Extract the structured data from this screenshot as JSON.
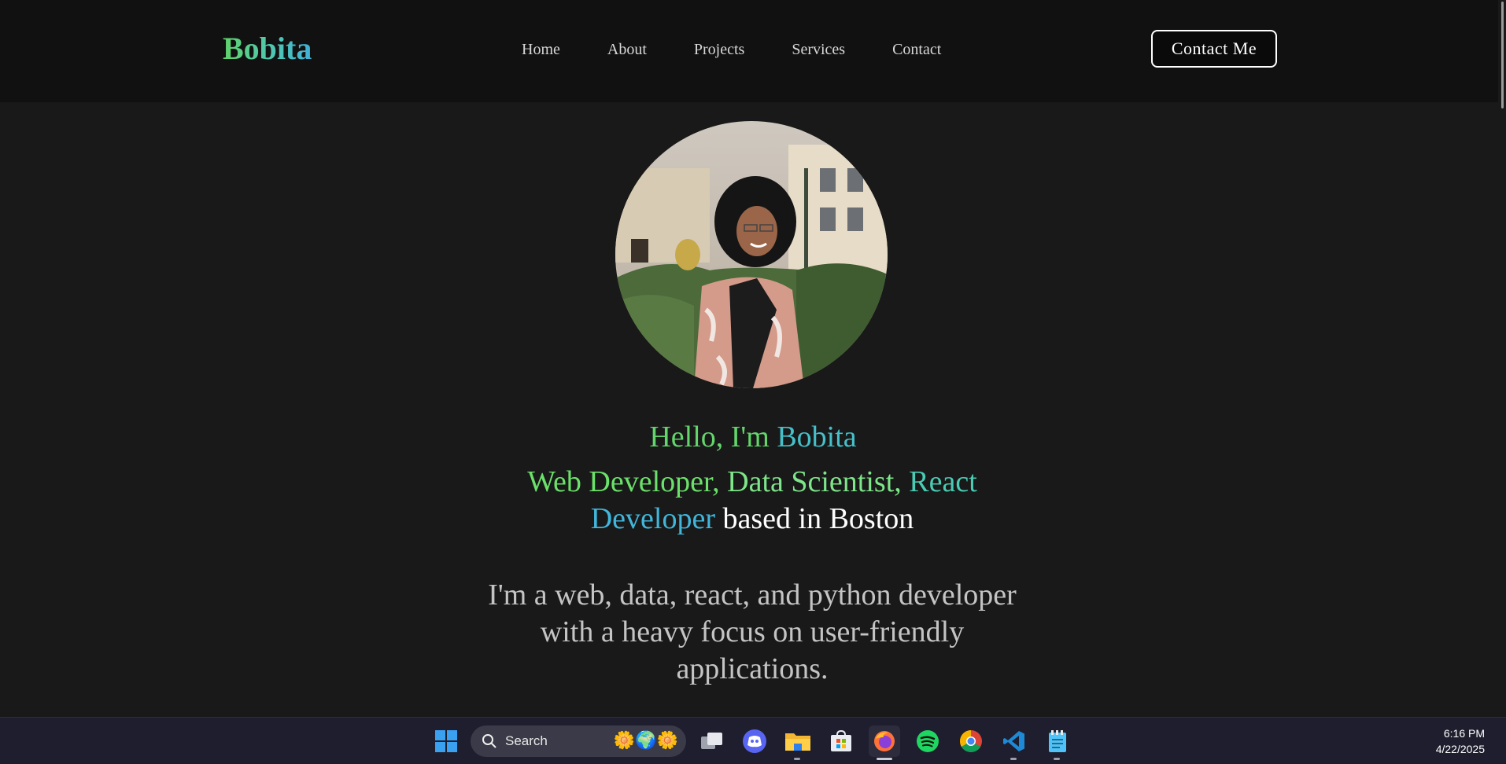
{
  "nav": {
    "logo": "Bobita",
    "links": [
      "Home",
      "About",
      "Projects",
      "Services",
      "Contact"
    ],
    "cta": "Contact Me"
  },
  "hero": {
    "avatar_alt": "Portrait of Bobita",
    "hello_prefix": "Hello, I'm ",
    "hello_name": "Bobita",
    "roles": {
      "r1": "Web Developer,",
      "r2": " Data Scientist,",
      "r3": " React",
      "r4": "Developer",
      "suffix": " based in Boston"
    },
    "bio": "I'm a web, data, react, and python developer with a heavy focus on user-friendly applications."
  },
  "taskbar": {
    "search_label": "Search",
    "apps": [
      "start-icon",
      "task-view-icon",
      "discord-icon",
      "file-explorer-icon",
      "microsoft-store-icon",
      "firefox-icon",
      "spotify-icon",
      "chrome-icon",
      "vscode-icon",
      "notepad-icon"
    ],
    "time": "6:16 PM",
    "date": "4/22/2025"
  },
  "colors": {
    "background": "#191919",
    "navbar": "#111111",
    "accent_green": "#63d66b",
    "accent_blue": "#41b6da"
  }
}
